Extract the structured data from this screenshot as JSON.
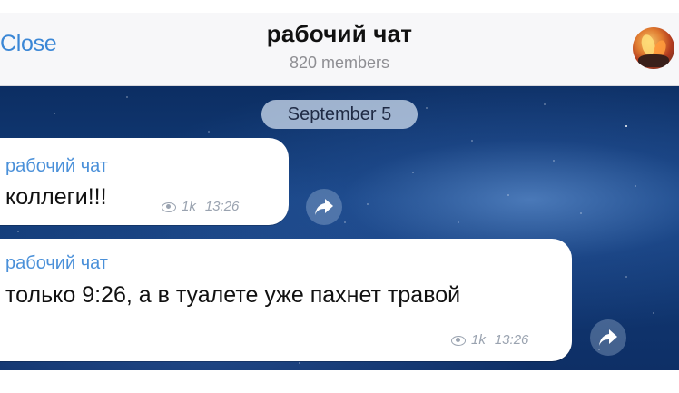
{
  "header": {
    "close_label": "Close",
    "title": "рабочий чат",
    "members": "820 members"
  },
  "chat": {
    "date": "September 5",
    "messages": [
      {
        "sender": "рабочий чат",
        "text": "коллеги!!!",
        "views": "1k",
        "time": "13:26"
      },
      {
        "sender": "рабочий чат",
        "text": "только 9:26, а в туалете уже пахнет травой",
        "views": "1k",
        "time": "13:26"
      }
    ]
  },
  "colors": {
    "accent": "#3b87d6",
    "sender": "#4a90d9",
    "background": "#123d7a"
  },
  "icons": [
    "eye-icon",
    "share-icon",
    "avatar-image"
  ]
}
